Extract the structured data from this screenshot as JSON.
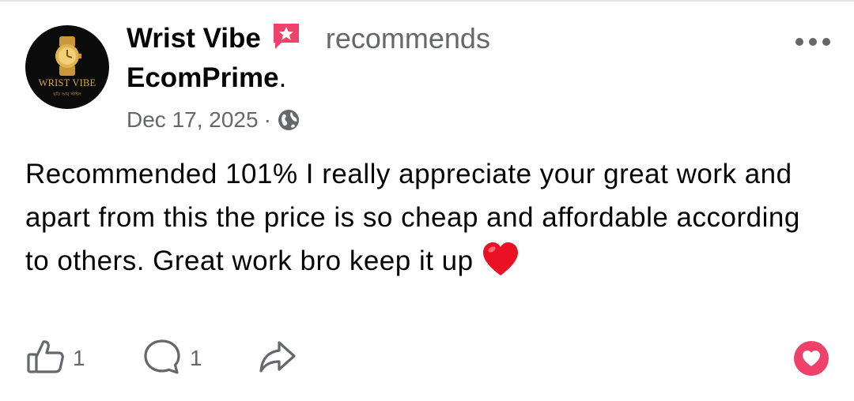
{
  "post": {
    "author": {
      "name": "Wrist Vibe",
      "avatar_title": "WRIST VIBE",
      "avatar_icon": "gold-watch-logo"
    },
    "verb": "recommends",
    "page": {
      "name": "EcomPrime",
      "suffix": "."
    },
    "meta": {
      "date": "Dec 17, 2025",
      "separator": "·",
      "privacy_icon": "globe-icon"
    },
    "body_text": "Recommended 101% I really appreciate your great work and apart from this the price is so cheap and affordable according to others. Great work bro keep it up",
    "body_emoji": "red-heart-emoji",
    "actions": {
      "like_count": "1",
      "comment_count": "1",
      "share_icon": "share-arrow-icon",
      "reaction_icon": "love-reaction-icon"
    },
    "colors": {
      "primary_text": "#050505",
      "secondary_text": "#65676b",
      "recommend_badge": "#f0416a",
      "love_reaction": "#f0416a",
      "avatar_background": "#0b0b0b",
      "avatar_gold": "#d4a64a"
    }
  }
}
